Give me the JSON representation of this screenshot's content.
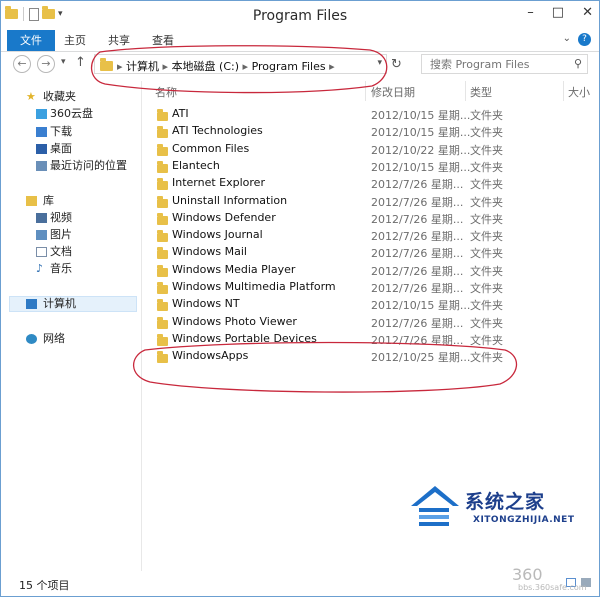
{
  "window": {
    "title": "Program Files"
  },
  "ribbon": {
    "tabs": [
      "文件",
      "主页",
      "共享",
      "查看"
    ]
  },
  "address": {
    "crumbs": [
      "计算机",
      "本地磁盘 (C:)",
      "Program Files"
    ]
  },
  "search": {
    "placeholder": "搜索 Program Files"
  },
  "columns": {
    "name": "名称",
    "date": "修改日期",
    "type": "类型",
    "size": "大小"
  },
  "nav": {
    "favorites": {
      "label": "收藏夹",
      "items": [
        "360云盘",
        "下载",
        "桌面",
        "最近访问的位置"
      ]
    },
    "libraries": {
      "label": "库",
      "items": [
        "视频",
        "图片",
        "文档",
        "音乐"
      ]
    },
    "computer": "计算机",
    "network": "网络"
  },
  "files": [
    {
      "name": "ATI",
      "date": "2012/10/15 星期...",
      "type": "文件夹"
    },
    {
      "name": "ATI Technologies",
      "date": "2012/10/15 星期...",
      "type": "文件夹"
    },
    {
      "name": "Common Files",
      "date": "2012/10/22 星期...",
      "type": "文件夹"
    },
    {
      "name": "Elantech",
      "date": "2012/10/15 星期...",
      "type": "文件夹"
    },
    {
      "name": "Internet Explorer",
      "date": "2012/7/26 星期...",
      "type": "文件夹"
    },
    {
      "name": "Uninstall Information",
      "date": "2012/7/26 星期...",
      "type": "文件夹"
    },
    {
      "name": "Windows Defender",
      "date": "2012/7/26 星期...",
      "type": "文件夹"
    },
    {
      "name": "Windows Journal",
      "date": "2012/7/26 星期...",
      "type": "文件夹"
    },
    {
      "name": "Windows Mail",
      "date": "2012/7/26 星期...",
      "type": "文件夹"
    },
    {
      "name": "Windows Media Player",
      "date": "2012/7/26 星期...",
      "type": "文件夹"
    },
    {
      "name": "Windows Multimedia Platform",
      "date": "2012/7/26 星期...",
      "type": "文件夹"
    },
    {
      "name": "Windows NT",
      "date": "2012/10/15 星期...",
      "type": "文件夹"
    },
    {
      "name": "Windows Photo Viewer",
      "date": "2012/7/26 星期...",
      "type": "文件夹"
    },
    {
      "name": "Windows Portable Devices",
      "date": "2012/7/26 星期...",
      "type": "文件夹"
    },
    {
      "name": "WindowsApps",
      "date": "2012/10/25 星期...",
      "type": "文件夹"
    }
  ],
  "status": {
    "count": "15 个项目"
  },
  "watermark": {
    "brand": "系统之家",
    "site": "XITONGZHIJIA.NET",
    "logo": "360",
    "logo_sub": "bbs.360safe.com"
  },
  "colors": {
    "accent": "#1979ca",
    "folder": "#e8c048",
    "annotation": "#c8283c"
  }
}
